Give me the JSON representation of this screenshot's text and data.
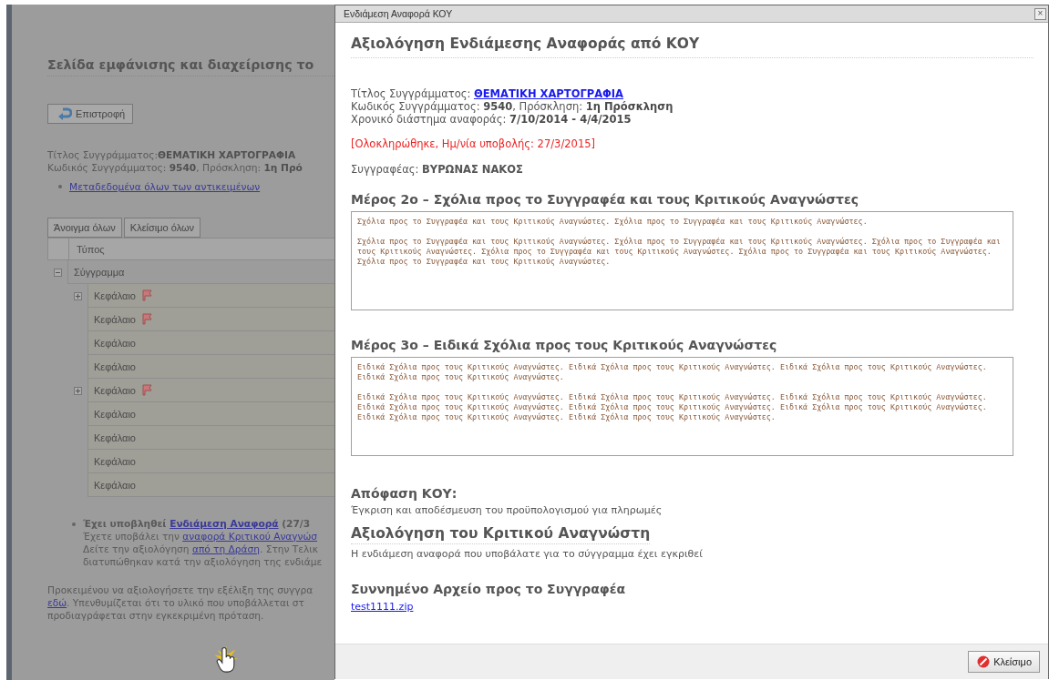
{
  "page": {
    "title": "Σελίδα εμφάνισης και διαχείρισης το",
    "back_button": "Επιστροφή",
    "info_lines": [
      [
        {
          "text": "Τίτλος Συγγράμματος:",
          "kind": "plain"
        },
        {
          "text": "ΘΕΜΑΤΙΚΗ ΧΑΡΤΟΓΡΑΦΙΑ",
          "kind": "bold"
        }
      ],
      [
        {
          "text": "Κωδικός Συγγράμματος: ",
          "kind": "plain"
        },
        {
          "text": "9540",
          "kind": "bold"
        },
        {
          "text": ", Πρόσκληση: ",
          "kind": "plain"
        },
        {
          "text": "1η Πρό",
          "kind": "bold"
        }
      ]
    ],
    "metadata_link": "Μεταδεδομένα όλων των αντικειμένων",
    "expand_all": "Άνοιγμα όλων",
    "collapse_all": "Κλείσιμο όλων",
    "tree_header": "Τύπος",
    "tree": {
      "label": "Σύγγραμμα",
      "expanded": true,
      "children": [
        {
          "label": "Κεφάλαιο",
          "has_children": true,
          "flagged": true
        },
        {
          "label": "Κεφάλαιο",
          "has_children": false,
          "flagged": true
        },
        {
          "label": "Κεφάλαιο",
          "has_children": false,
          "flagged": false
        },
        {
          "label": "Κεφάλαιο",
          "has_children": false,
          "flagged": false
        },
        {
          "label": "Κεφάλαιο",
          "has_children": true,
          "flagged": true
        },
        {
          "label": "Κεφάλαιο",
          "has_children": false,
          "flagged": false
        },
        {
          "label": "Κεφάλαιο",
          "has_children": false,
          "flagged": false
        },
        {
          "label": "Κεφάλαιο",
          "has_children": false,
          "flagged": false
        },
        {
          "label": "Κεφάλαιο",
          "has_children": false,
          "flagged": false
        }
      ]
    },
    "notice_lines": [
      [
        {
          "text": "Έχει υποβληθεί ",
          "kind": "bold"
        },
        {
          "text": "Ενδιάμεση Αναφορά",
          "kind": "boldlink"
        },
        {
          "text": " (27/3",
          "kind": "bold"
        }
      ],
      [
        {
          "text": "Έχετε υποβάλει την ",
          "kind": "plain"
        },
        {
          "text": "αναφορά Κριτικού Αναγνώσ",
          "kind": "link"
        }
      ],
      [
        {
          "text": "Δείτε την αξιολόγηση ",
          "kind": "plain"
        },
        {
          "text": "από τη Δράση",
          "kind": "link"
        },
        {
          "text": ". Στην Τελικ",
          "kind": "plain"
        }
      ],
      [
        {
          "text": "διατυπώθηκαν κατά την αξιολόγηση της ενδιάμε",
          "kind": "plain"
        }
      ]
    ],
    "footer_lines": [
      [
        {
          "text": "Προκειμένου να αξιολογήσετε την εξέλιξη της συγγρα",
          "kind": "plain"
        }
      ],
      [
        {
          "text": "εδώ",
          "kind": "link"
        },
        {
          "text": ". Υπενθυμίζεται ότι το υλικό που υποβάλλεται στ",
          "kind": "plain"
        }
      ],
      [
        {
          "text": "προδιαγράφεται στην εγκεκριμένη πρόταση.",
          "kind": "plain"
        }
      ]
    ]
  },
  "dialog": {
    "title": "Ενδιάμεση Αναφορά ΚΟΥ",
    "close_glyph": "×",
    "heading": "Αξιολόγηση Ενδιάμεσης Αναφοράς από ΚΟΥ",
    "info_lines": [
      [
        {
          "text": "Τίτλος Συγγράμματος: ",
          "kind": "plain"
        },
        {
          "text": "ΘΕΜΑΤΙΚΗ ΧΑΡΤΟΓΡΑΦΙΑ",
          "kind": "boldlink"
        }
      ],
      [
        {
          "text": "Κωδικός Συγγράμματος: ",
          "kind": "plain"
        },
        {
          "text": "9540",
          "kind": "bold"
        },
        {
          "text": ", Πρόσκληση: ",
          "kind": "plain"
        },
        {
          "text": "1η Πρόσκληση",
          "kind": "bold"
        }
      ],
      [
        {
          "text": "Χρονικό διάστημα αναφοράς: ",
          "kind": "plain"
        },
        {
          "text": "7/10/2014 - 4/4/2015",
          "kind": "bold"
        }
      ]
    ],
    "status": "[Ολοκληρώθηκε, Ημ/νία υποβολής: 27/3/2015]",
    "author_label": "Συγγραφέας: ",
    "author": "ΒΥΡΩΝΑΣ ΝΑΚΟΣ",
    "part2_title": "Μέρος 2ο – Σχόλια προς το Συγγραφέα και τους Κριτικούς Αναγνώστες",
    "part2_text": "Σχόλια προς το Συγγραφέα και τους Κριτικούς Αναγνώστες. Σχόλια προς το Συγγραφέα και τους Κριτικούς Αναγνώστες.\n\nΣχόλια προς το Συγγραφέα και τους Κριτικούς Αναγνώστες. Σχόλια προς το Συγγραφέα και τους Κριτικούς Αναγνώστες. Σχόλια προς το Συγγραφέα και τους Κριτικούς Αναγνώστες. Σχόλια προς το Συγγραφέα και τους Κριτικούς Αναγνώστες. Σχόλια προς το Συγγραφέα και τους Κριτικούς Αναγνώστες. Σχόλια προς το Συγγραφέα και τους Κριτικούς Αναγνώστες.",
    "part3_title": "Μέρος 3ο – Ειδικά Σχόλια προς τους Κριτικούς Αναγνώστες",
    "part3_text": "Ειδικά Σχόλια προς τους Κριτικούς Αναγνώστες. Ειδικά Σχόλια προς τους Κριτικούς Αναγνώστες. Ειδικά Σχόλια προς τους Κριτικούς Αναγνώστες. Ειδικά Σχόλια προς τους Κριτικούς Αναγνώστες.\n\nΕιδικά Σχόλια προς τους Κριτικούς Αναγνώστες. Ειδικά Σχόλια προς τους Κριτικούς Αναγνώστες. Ειδικά Σχόλια προς τους Κριτικούς Αναγνώστες. Ειδικά Σχόλια προς τους Κριτικούς Αναγνώστες. Ειδικά Σχόλια προς τους Κριτικούς Αναγνώστες. Ειδικά Σχόλια προς τους Κριτικούς Αναγνώστες. Ειδικά Σχόλια προς τους Κριτικούς Αναγνώστες. Ειδικά Σχόλια προς τους Κριτικούς Αναγνώστες.",
    "decision_title": "Απόφαση ΚΟΥ:",
    "decision_text": "Έγκριση και αποδέσμευση του προϋπολογισμού για πληρωμές",
    "review_title": "Αξιολόγηση του Κριτικού Αναγνώστη",
    "review_text": "Η ενδιάμεση αναφορά που υποβάλατε για το σύγγραμμα έχει εγκριθεί",
    "attachment_title": "Συννημένο Αρχείο προς το Συγγραφέα",
    "attachment_link": "test1111.zip",
    "close_button": "Κλείσιμο"
  }
}
